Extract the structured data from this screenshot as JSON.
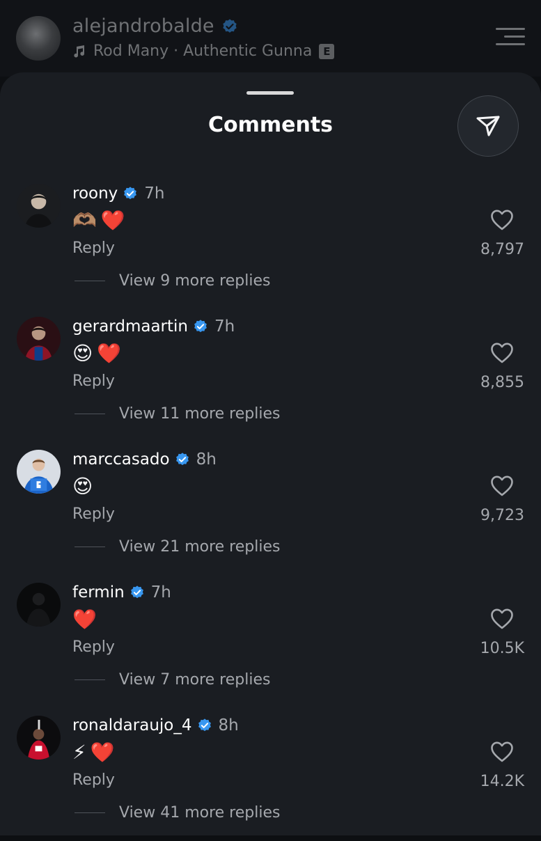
{
  "post": {
    "username": "alejandrobalde",
    "audio": "Rod Many · Authentic Gunna",
    "explicit_badge": "E"
  },
  "sheet": {
    "title": "Comments"
  },
  "comments": [
    {
      "username": "roony",
      "time": "7h",
      "emoji": [
        "🫶🏽",
        "❤️"
      ],
      "reply_label": "Reply",
      "likes": "8,797",
      "view_replies": "View 9 more replies"
    },
    {
      "username": "gerardmaartin",
      "time": "7h",
      "emoji": [
        "😍",
        "❤️"
      ],
      "reply_label": "Reply",
      "likes": "8,855",
      "view_replies": "View 11 more replies"
    },
    {
      "username": "marccasado",
      "time": "8h",
      "emoji": [
        "😍"
      ],
      "reply_label": "Reply",
      "likes": "9,723",
      "view_replies": "View 21 more replies"
    },
    {
      "username": "fermin",
      "time": "7h",
      "emoji": [
        "❤️"
      ],
      "reply_label": "Reply",
      "likes": "10.5K",
      "view_replies": "View 7 more replies"
    },
    {
      "username": "ronaldaraujo_4",
      "time": "8h",
      "emoji": [
        "⚡",
        "❤️"
      ],
      "reply_label": "Reply",
      "likes": "14.2K",
      "view_replies": "View 41 more replies"
    }
  ],
  "icons": {
    "post_audio": "music-note-icon",
    "verified": "verified-badge-icon",
    "menu": "menu-icon",
    "share": "send-icon",
    "like": "heart-icon"
  },
  "colors": {
    "background": "#0d0f12",
    "sheet": "#1a1d22",
    "verified": "#3897f0",
    "text_secondary": "#a5a8ad"
  }
}
